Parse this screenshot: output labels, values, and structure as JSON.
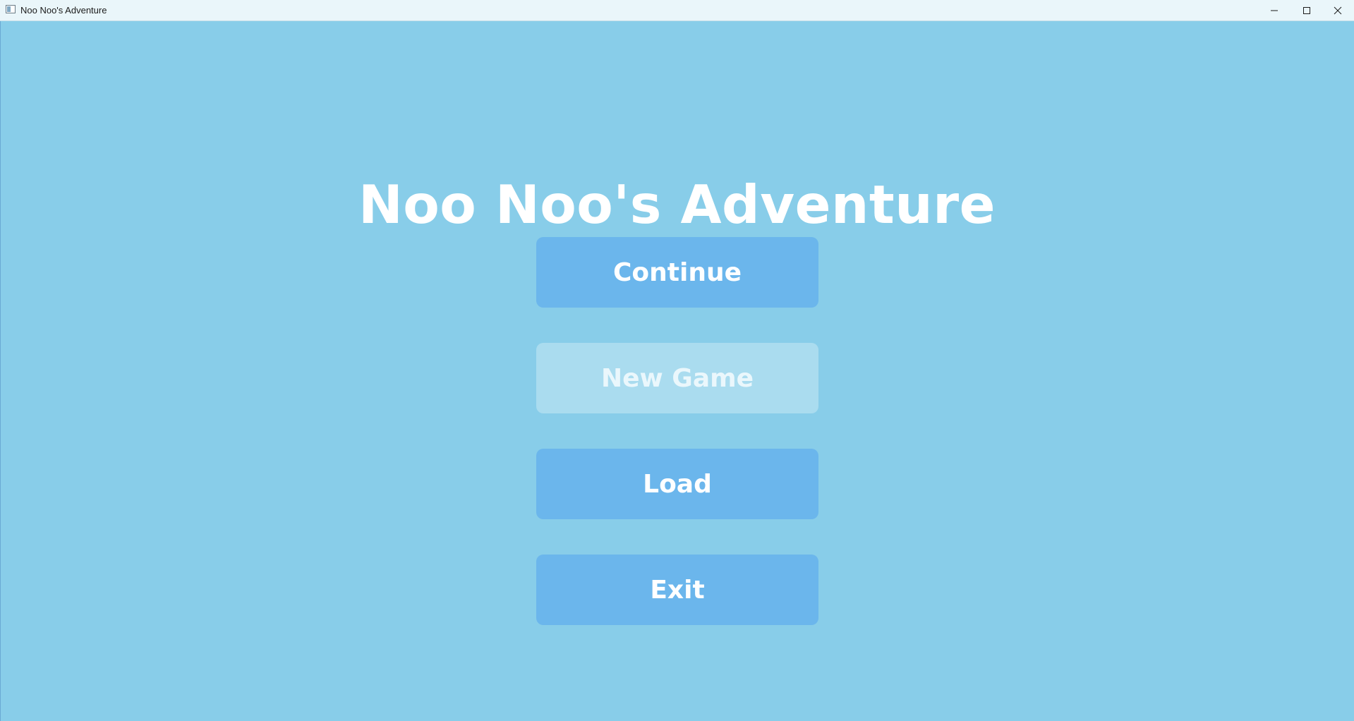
{
  "window": {
    "title": "Noo Noo's Adventure",
    "controls": {
      "minimize_icon": "minimize-icon",
      "maximize_icon": "maximize-icon",
      "close_icon": "close-icon"
    }
  },
  "game": {
    "title": "Noo Noo's Adventure"
  },
  "menu": {
    "continue_label": "Continue",
    "new_game_label": "New Game",
    "load_label": "Load",
    "exit_label": "Exit"
  },
  "colors": {
    "background": "#88cde9",
    "button": "#6bb6ec",
    "button_disabled": "#aadcef",
    "text": "#ffffff"
  }
}
